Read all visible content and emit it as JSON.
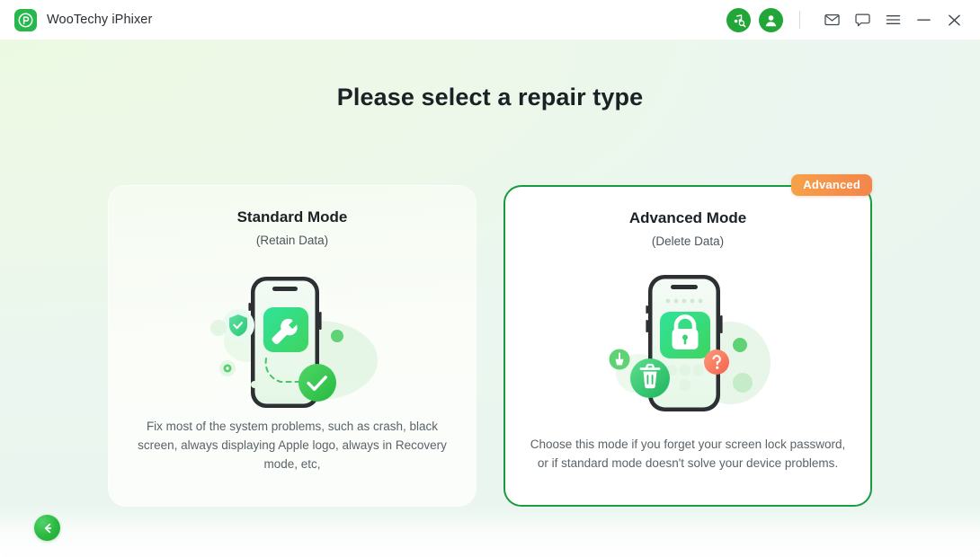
{
  "window": {
    "app_title": "WooTechy iPhixer",
    "logo_icon": "wootechy-logo-icon",
    "toolbar_icons": [
      {
        "name": "music-search-icon",
        "color": "#23a638"
      },
      {
        "name": "user-account-icon",
        "color": "#23a638"
      }
    ],
    "controls": [
      {
        "name": "mail-icon"
      },
      {
        "name": "feedback-chat-icon"
      },
      {
        "name": "menu-icon"
      },
      {
        "name": "minimize-icon"
      },
      {
        "name": "close-icon"
      }
    ]
  },
  "main": {
    "title": "Please select a repair type",
    "cards": [
      {
        "id": "standard",
        "title": "Standard Mode",
        "subtitle": "(Retain Data)",
        "description": "Fix most of the system problems, such as crash, black screen, always displaying Apple logo, always in Recovery mode, etc,",
        "selected": false,
        "badge": null,
        "illustration": "phone-wrench-illustration"
      },
      {
        "id": "advanced",
        "title": "Advanced Mode",
        "subtitle": "(Delete Data)",
        "description": "Choose this mode if you forget your screen lock password, or if standard mode doesn't solve your device problems.",
        "selected": true,
        "badge": "Advanced",
        "illustration": "phone-lock-illustration"
      }
    ]
  },
  "footer": {
    "back_button_icon": "arrow-left-icon"
  },
  "colors": {
    "brand_green": "#23a638",
    "selected_border": "#179b40",
    "badge_orange": "#f5914b",
    "page_bg": "#eef8e9"
  }
}
